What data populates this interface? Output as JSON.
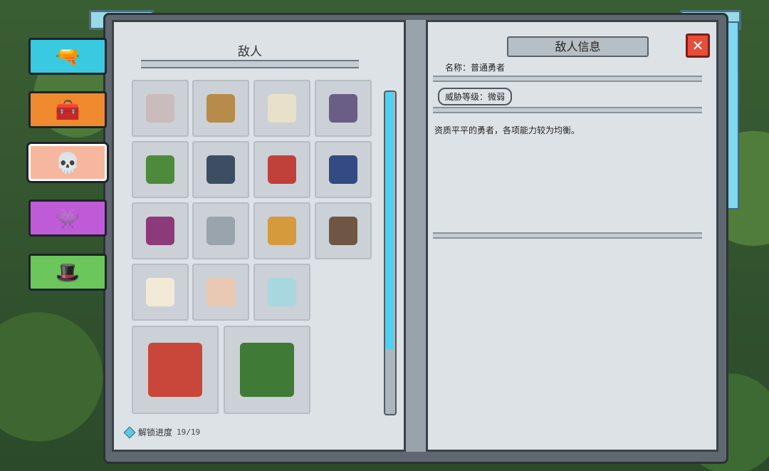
{
  "left_page": {
    "title": "敌人"
  },
  "progress": {
    "label": "解锁进度",
    "value": "19/19"
  },
  "info": {
    "title": "敌人信息",
    "name_line": "名称：普通勇者",
    "threat_line": "威胁等级：微弱",
    "description": "资质平平的勇者，各项能力较为均衡。"
  },
  "tabs": [
    "weapon",
    "chest",
    "enemy",
    "boss",
    "npc"
  ],
  "icons": {
    "weapon": "gun-icon",
    "chest": "chest-icon",
    "enemy": "skull-icon",
    "boss": "demon-icon",
    "npc": "hat-icon",
    "close": "close-icon"
  },
  "colors": {
    "accent": "#4fd2ef",
    "close": "#e54e3b",
    "selected_tab": "#f7b79e"
  },
  "enemies": [
    "hero-basic-faded",
    "hero-knight",
    "hero-white-cleric",
    "hero-dark-swordsman",
    "hero-archer-green",
    "hero-bomber",
    "hero-priest-red",
    "hero-mage-blue",
    "hero-witch-purple",
    "hero-armored-knight",
    "hero-miner-axe",
    "hero-boar-rider",
    "sheep",
    "sheep-bell",
    "ghost",
    "hero-red-swordsman-large",
    "hero-green-archer-large"
  ]
}
